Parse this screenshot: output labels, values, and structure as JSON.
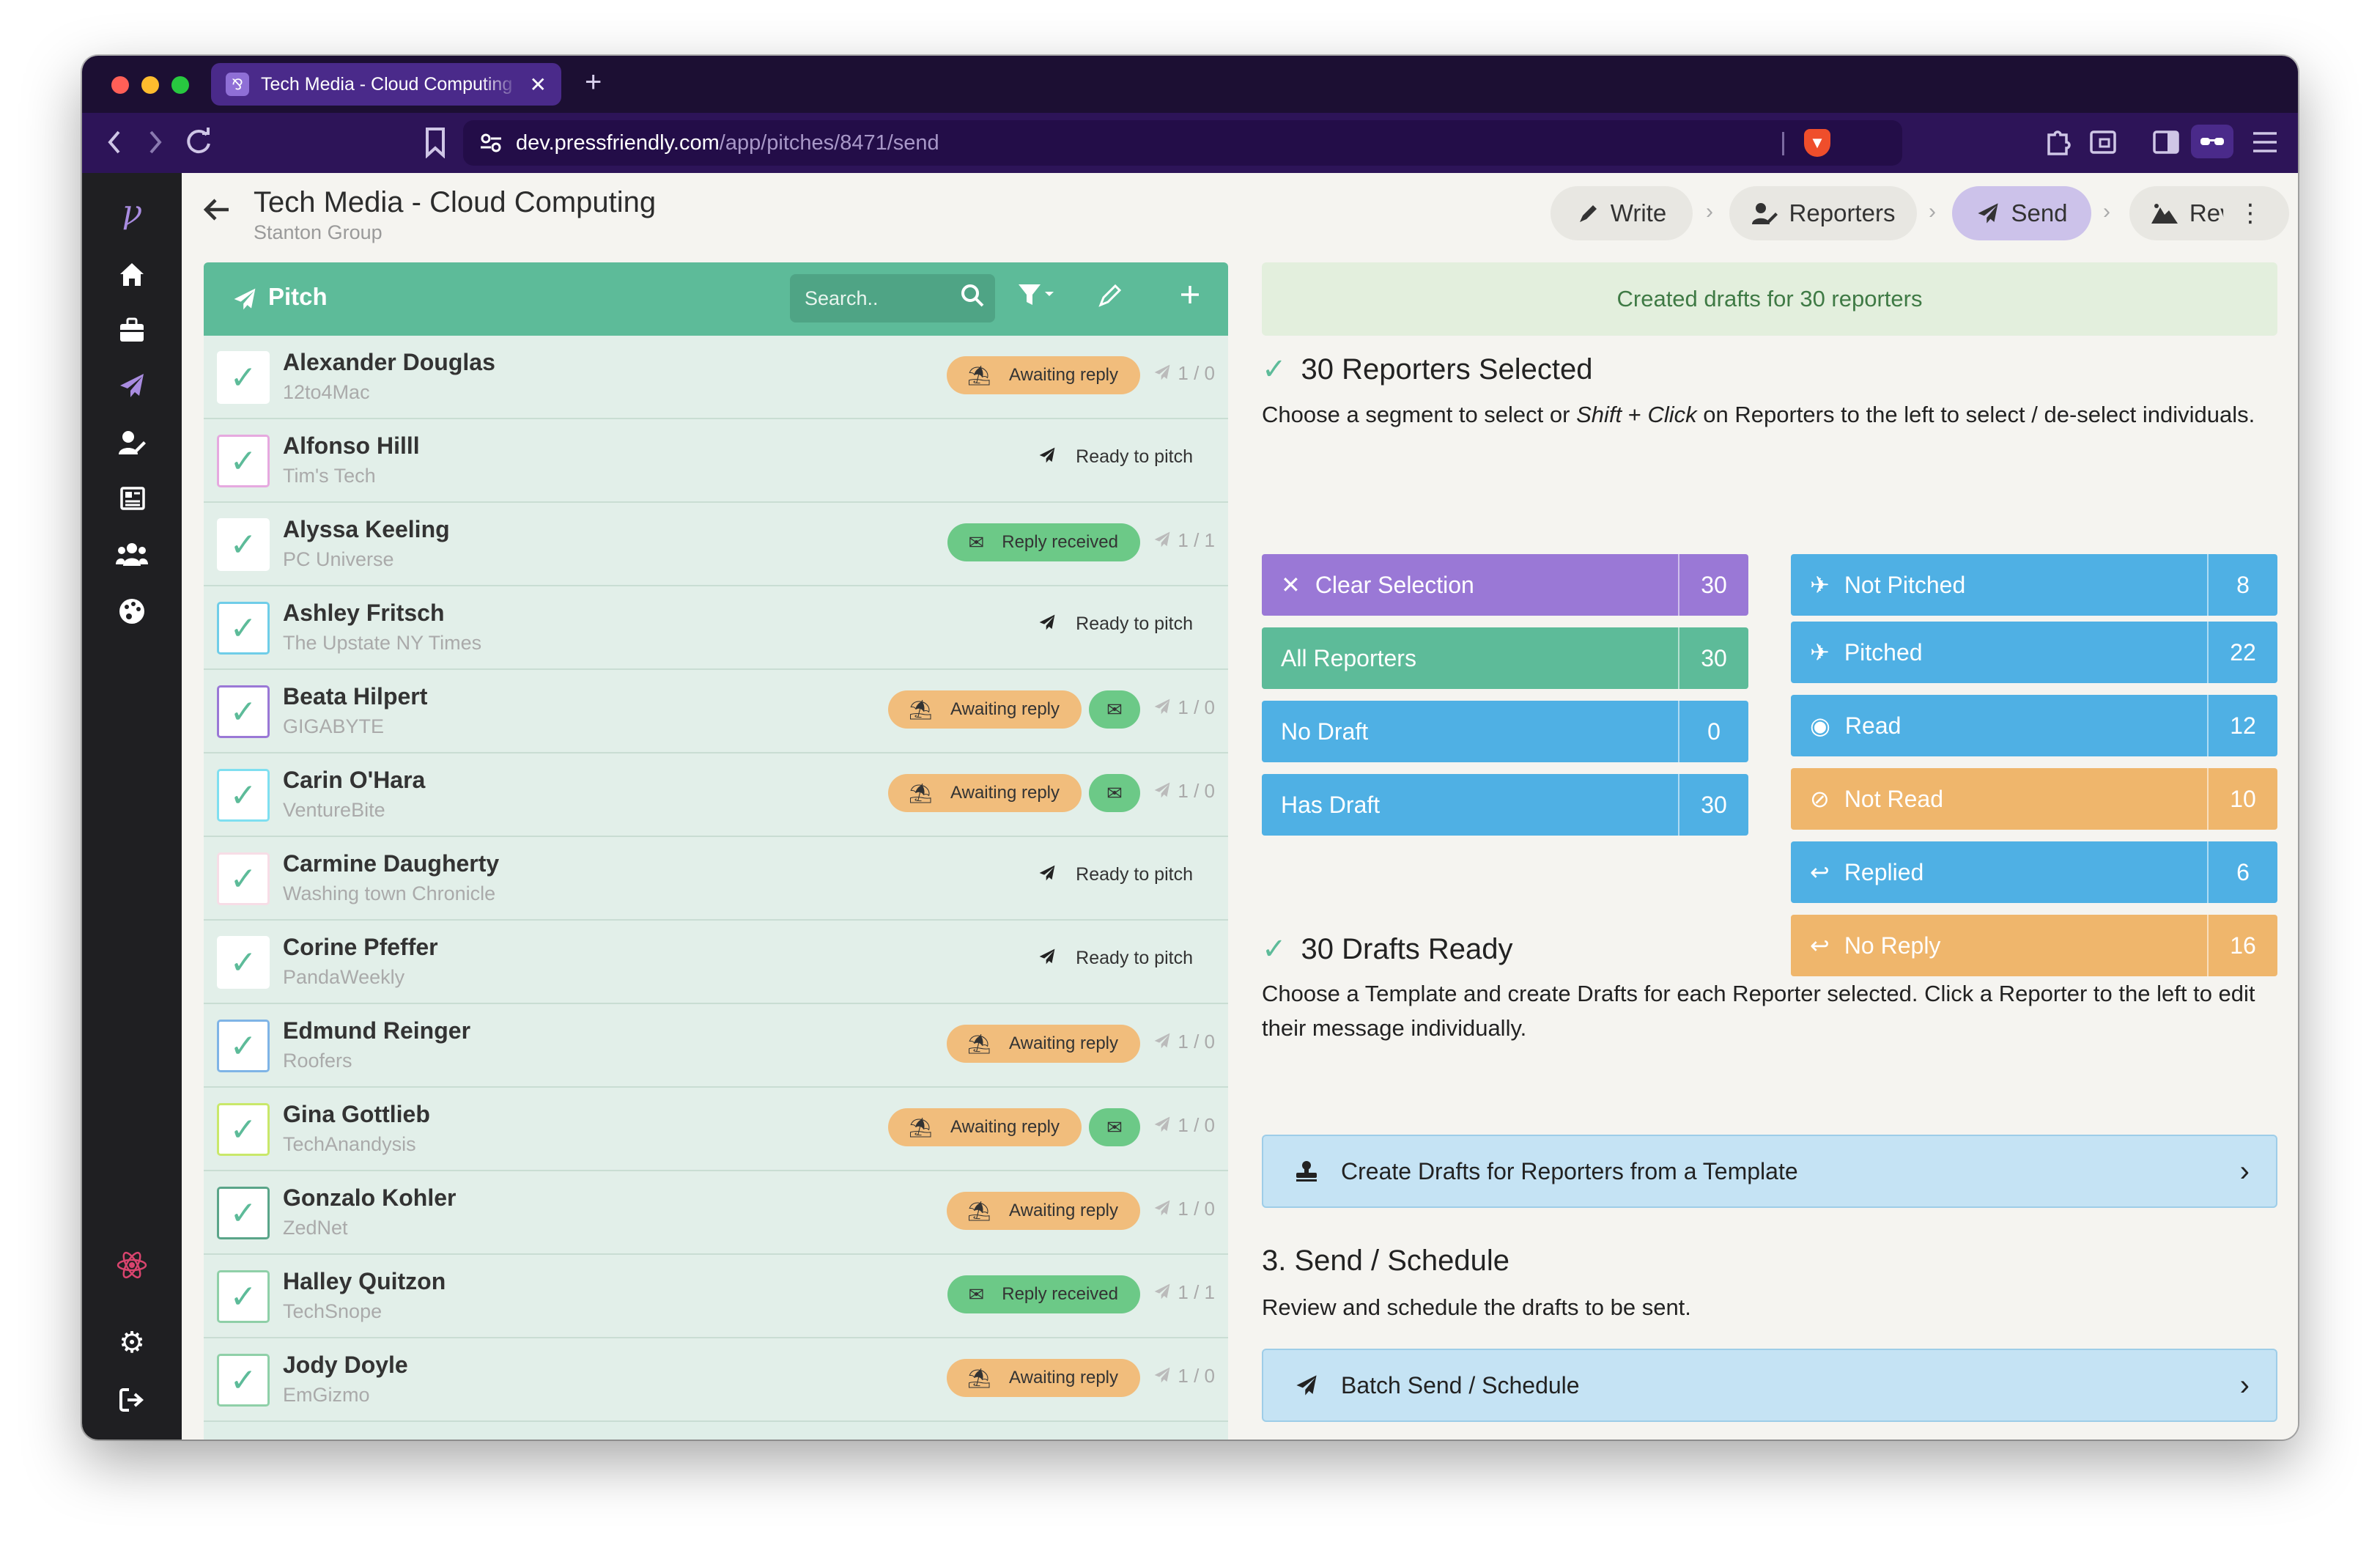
{
  "browser": {
    "tab_title": "Tech Media - Cloud Computing",
    "tab_favicon": "⅋",
    "tab_close": "✕",
    "new_tab": "+",
    "url_host": "dev.pressfriendly.com",
    "url_path": "/app/pitches/8471/send",
    "colors": {
      "titlebar": "#1c0f33",
      "navbar": "#2d1458",
      "active_tab": "#4a2a8a"
    }
  },
  "sidebar": {
    "items": [
      {
        "icon": "logo-icon"
      },
      {
        "icon": "home-icon"
      },
      {
        "icon": "briefcase-icon"
      },
      {
        "icon": "paper-plane-icon"
      },
      {
        "icon": "user-edit-icon"
      },
      {
        "icon": "newspaper-icon"
      },
      {
        "icon": "users-icon"
      },
      {
        "icon": "palette-icon"
      },
      {
        "icon": "react-icon"
      },
      {
        "icon": "gear-icon"
      },
      {
        "icon": "logout-icon"
      }
    ]
  },
  "header": {
    "title": "Tech Media - Cloud Computing",
    "subtitle": "Stanton Group",
    "steps": [
      {
        "label": "Write",
        "icon": "pen-icon"
      },
      {
        "label": "Reporters",
        "icon": "user-edit-icon"
      },
      {
        "label": "Send",
        "icon": "paper-plane-icon",
        "active": true
      },
      {
        "label": "Review",
        "icon": "mountain-icon"
      }
    ]
  },
  "list": {
    "title": "Pitch",
    "search_placeholder": "Search..",
    "accent": "#5dbb99",
    "rows": [
      {
        "name": "Alexander Douglas",
        "org": "12to4Mac",
        "status": "Awaiting reply",
        "kind": "await",
        "count": "1 / 0",
        "cb": "#ffffff"
      },
      {
        "name": "Alfonso Hilll",
        "org": "Tim's Tech",
        "status": "Ready to pitch",
        "kind": "ready",
        "count": "",
        "cb": "#e6a9df"
      },
      {
        "name": "Alyssa Keeling",
        "org": "PC Universe",
        "status": "Reply received",
        "kind": "reply",
        "count": "1 / 1",
        "cb": "#ffffff"
      },
      {
        "name": "Ashley Fritsch",
        "org": "The Upstate NY Times",
        "status": "Ready to pitch",
        "kind": "ready",
        "count": "",
        "cb": "#6fcde8"
      },
      {
        "name": "Beata Hilpert",
        "org": "GIGABYTE",
        "status": "Awaiting reply",
        "kind": "await-mini",
        "count": "1 / 0",
        "cb": "#9a78d6"
      },
      {
        "name": "Carin O'Hara",
        "org": "VentureBite",
        "status": "Awaiting reply",
        "kind": "await-mini",
        "count": "1 / 0",
        "cb": "#7fdff0"
      },
      {
        "name": "Carmine Daugherty",
        "org": "Washing town Chronicle",
        "status": "Ready to pitch",
        "kind": "ready",
        "count": "",
        "cb": "#f7dde6"
      },
      {
        "name": "Corine Pfeffer",
        "org": "PandaWeekly",
        "status": "Ready to pitch",
        "kind": "ready",
        "count": "",
        "cb": "#ffffff"
      },
      {
        "name": "Edmund Reinger",
        "org": "Roofers",
        "status": "Awaiting reply",
        "kind": "await",
        "count": "1 / 0",
        "cb": "#7fb4e6"
      },
      {
        "name": "Gina Gottlieb",
        "org": "TechAnandysis",
        "status": "Awaiting reply",
        "kind": "await-mini",
        "count": "1 / 0",
        "cb": "#c9e86a"
      },
      {
        "name": "Gonzalo Kohler",
        "org": "ZedNet",
        "status": "Awaiting reply",
        "kind": "await",
        "count": "1 / 0",
        "cb": "#5aa589"
      },
      {
        "name": "Halley Quitzon",
        "org": "TechSnope",
        "status": "Reply received",
        "kind": "reply",
        "count": "1 / 1",
        "cb": "#8fd0a8"
      },
      {
        "name": "Jody Doyle",
        "org": "EmGizmo",
        "status": "Awaiting reply",
        "kind": "await",
        "count": "1 / 0",
        "cb": "#8fd0a8"
      }
    ]
  },
  "panel": {
    "banner": "Created drafts for 30 reporters",
    "selected_heading": "30 Reporters Selected",
    "selected_text_1": "Choose a segment to select or ",
    "selected_text_shift": "Shift",
    "selected_text_plus": " + ",
    "selected_text_click": "Click",
    "selected_text_2": " on Reporters to the left to select / de-select individuals.",
    "segments_left": [
      {
        "label": "Clear Selection",
        "count": "30",
        "icon": "✕",
        "color": "#9a78d6"
      },
      {
        "label": "All Reporters",
        "count": "30",
        "icon": "",
        "color": "#5dbb99"
      },
      {
        "label": "No Draft",
        "count": "0",
        "icon": "",
        "color": "#4fb0e4"
      },
      {
        "label": "Has Draft",
        "count": "30",
        "icon": "",
        "color": "#4fb0e4"
      }
    ],
    "segments_right": [
      {
        "label": "Not Pitched",
        "count": "8",
        "icon": "✈",
        "color": "#4fb0e4"
      },
      {
        "label": "Pitched",
        "count": "22",
        "icon": "✈",
        "color": "#4fb0e4"
      },
      {
        "label": "Read",
        "count": "12",
        "icon": "◉",
        "color": "#4fb0e4"
      },
      {
        "label": "Not Read",
        "count": "10",
        "icon": "⊘",
        "color": "#efb66c"
      },
      {
        "label": "Replied",
        "count": "6",
        "icon": "↩",
        "color": "#4fb0e4"
      },
      {
        "label": "No Reply",
        "count": "16",
        "icon": "↩",
        "color": "#efb66c"
      }
    ],
    "drafts_heading": "30 Drafts Ready",
    "drafts_text": "Choose a Template and create Drafts for each Reporter selected. Click a Reporter to the left to edit their message individually.",
    "drafts_button": "Create Drafts for Reporters from a Template",
    "send_heading": "3. Send / Schedule",
    "send_text": "Review and schedule the drafts to be sent.",
    "send_button": "Batch Send / Schedule"
  }
}
